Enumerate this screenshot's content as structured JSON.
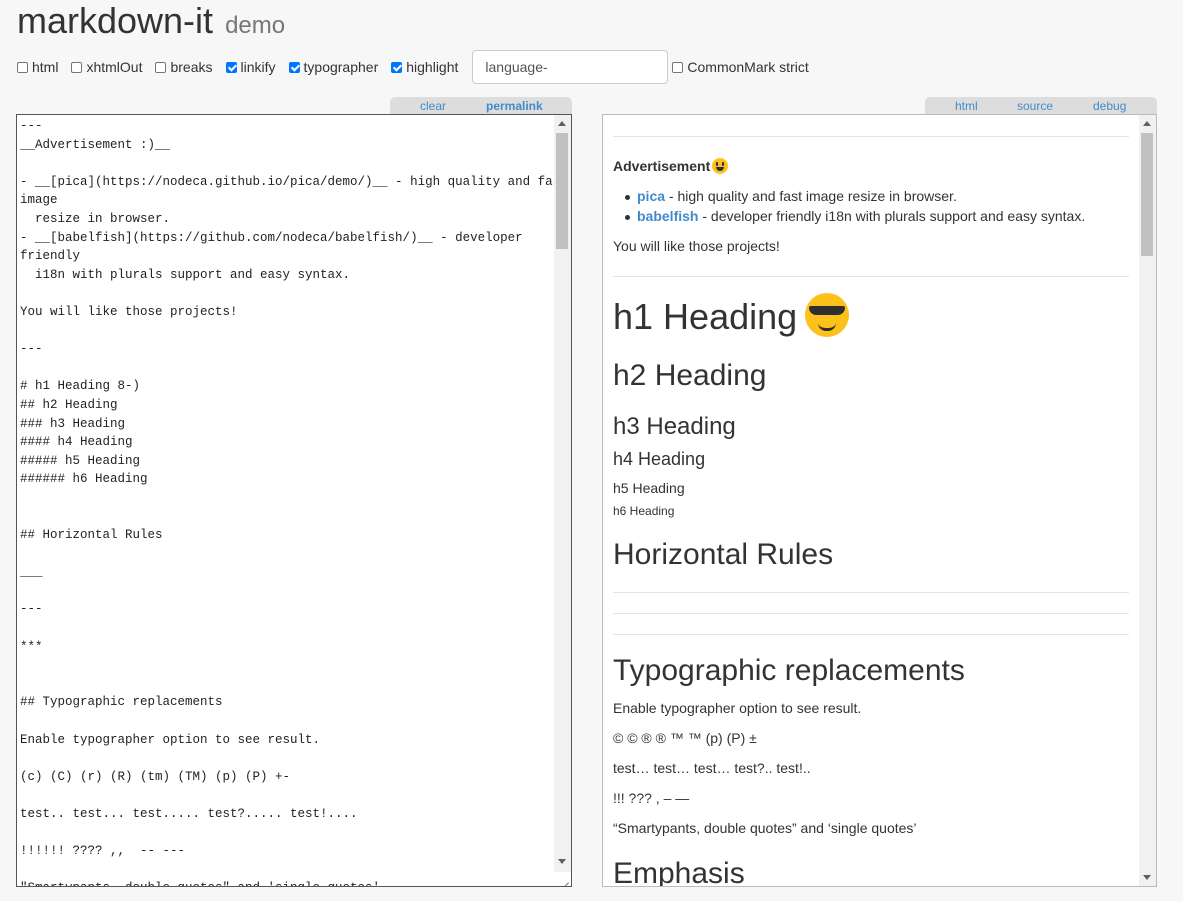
{
  "header": {
    "title": "markdown-it",
    "subtitle": "demo"
  },
  "options": {
    "html": {
      "label": "html",
      "checked": false
    },
    "xhtmlOut": {
      "label": "xhtmlOut",
      "checked": false
    },
    "breaks": {
      "label": "breaks",
      "checked": false
    },
    "linkify": {
      "label": "linkify",
      "checked": true
    },
    "typographer": {
      "label": "typographer",
      "checked": true
    },
    "highlight": {
      "label": "highlight",
      "checked": true
    },
    "lang_placeholder": "language-",
    "commonmark": {
      "label": "CommonMark strict",
      "checked": false
    }
  },
  "source_tabs": {
    "clear": "clear",
    "permalink": "permalink"
  },
  "result_tabs": {
    "html": "html",
    "source": "source",
    "debug": "debug"
  },
  "source": {
    "lines": [
      "---",
      "__Advertisement :)__",
      "",
      "- __[pica](https://nodeca.github.io/pica/demo/)__ - high quality and fast",
      "image",
      "  resize in browser.",
      "- __[babelfish](https://github.com/nodeca/babelfish/)__ - developer",
      "friendly",
      "  i18n with plurals support and easy syntax.",
      "",
      "You will like those projects!",
      "",
      "---",
      "",
      "# h1 Heading 8-)",
      "## h2 Heading",
      "### h3 Heading",
      "#### h4 Heading",
      "##### h5 Heading",
      "###### h6 Heading",
      "",
      "",
      "## Horizontal Rules",
      "",
      "___",
      "",
      "---",
      "",
      "***",
      "",
      "",
      "## Typographic replacements",
      "",
      "Enable typographer option to see result.",
      "",
      "(c) (C) (r) (R) (tm) (TM) (p) (P) +-",
      "",
      "test.. test... test..... test?..... test!....",
      "",
      "!!!!!! ???? ,,  -- ---",
      "",
      "\"Smartypants, double quotes\" and 'single quotes'"
    ]
  },
  "result": {
    "advertisement": "Advertisement",
    "list": [
      {
        "link": "pica",
        "text": " - high quality and fast image resize in browser."
      },
      {
        "link": "babelfish",
        "text": " - developer friendly i18n with plurals support and easy syntax."
      }
    ],
    "projects": "You will like those projects!",
    "h1": "h1 Heading",
    "h2": "h2 Heading",
    "h3": "h3 Heading",
    "h4": "h4 Heading",
    "h5": "h5 Heading",
    "h6": "h6 Heading",
    "hr_heading": "Horizontal Rules",
    "typo_heading": "Typographic replacements",
    "typo_p1": "Enable typographer option to see result.",
    "typo_p2": "© © ® ® ™ ™ (p) (P) ±",
    "typo_p3": "test… test… test… test?.. test!..",
    "typo_p4": "!!! ??? , – —",
    "typo_p5": "“Smartypants, double quotes” and ‘single quotes’",
    "emphasis_heading": "Emphasis"
  }
}
